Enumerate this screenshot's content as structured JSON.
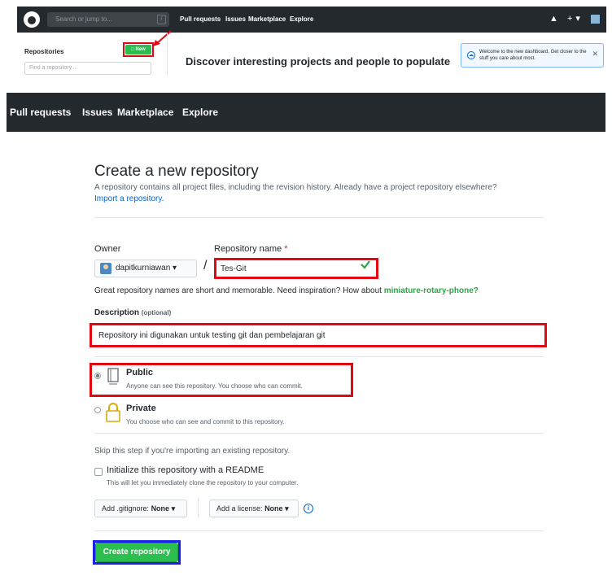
{
  "top_screenshot": {
    "search_placeholder": "Search or jump to...",
    "search_shortcut": "/",
    "nav": [
      "Pull requests",
      "Issues",
      "Marketplace",
      "Explore"
    ],
    "icons_text": "▲ +▾",
    "repositories_label": "Repositories",
    "new_button": "□ New",
    "find_repo_placeholder": "Find a repository...",
    "discover_text": "Discover interesting projects and people to populate",
    "welcome_text": "Welcome to the new dashboard. Get closer to the stuff you care about most.",
    "welcome_close": "✕",
    "welcome_icon": "☁"
  },
  "header": {
    "nav": [
      "Pull requests",
      "Issues",
      "Marketplace",
      "Explore"
    ]
  },
  "form": {
    "title": "Create a new repository",
    "subtitle": "A repository contains all project files, including the revision history. Already have a project repository elsewhere?",
    "import_link": "Import a repository.",
    "owner_label": "Owner",
    "owner_value": "dapitkurniawan ▾",
    "repo_name_label": "Repository name",
    "required_mark": "*",
    "separator": "/",
    "repo_name_value": "Tes-Git",
    "name_hint": "Great repository names are short and memorable. Need inspiration? How about",
    "name_suggestion": "miniature-rotary-phone?",
    "description_label": "Description",
    "description_optional": "(optional)",
    "description_value": "Repository ini digunakan untuk testing git dan pembelajaran git",
    "visibility": [
      {
        "title": "Public",
        "desc": "Anyone can see this repository. You choose who can commit.",
        "checked": true
      },
      {
        "title": "Private",
        "desc": "You choose who can see and commit to this repository.",
        "checked": false
      }
    ],
    "skip_text": "Skip this step if you're importing an existing repository.",
    "readme_label": "Initialize this repository with a README",
    "readme_desc": "This will let you immediately clone the repository to your computer.",
    "gitignore_label": "Add .gitignore:",
    "gitignore_value": "None ▾",
    "license_label": "Add a license:",
    "license_value": "None ▾",
    "info_icon": "i",
    "create_button": "Create repository"
  },
  "colors": {
    "header_bg": "#24292e",
    "highlight_red": "#e30613",
    "highlight_blue": "#1a21e6",
    "create_green": "#2cbe4e",
    "link_blue": "#0366d6"
  }
}
